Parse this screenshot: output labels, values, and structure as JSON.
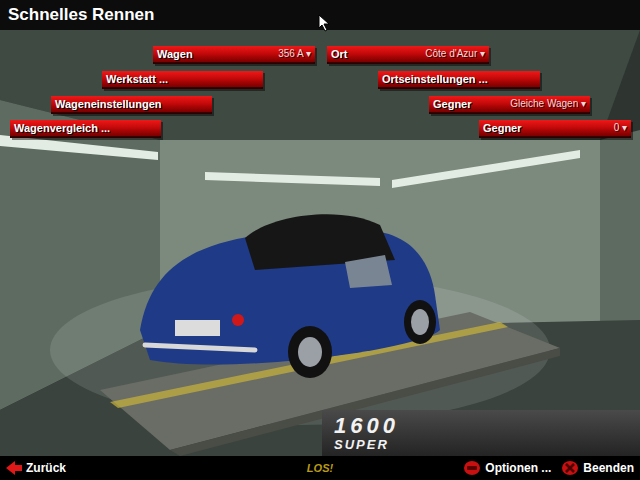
{
  "screen": {
    "title": "Schnelles Rennen"
  },
  "menu_left": [
    {
      "kind": "dropdown",
      "label": "Wagen",
      "value": "356 A",
      "arrow": "▾"
    },
    {
      "kind": "button",
      "label": "Werkstatt ..."
    },
    {
      "kind": "button",
      "label": "Wageneinstellungen"
    },
    {
      "kind": "button",
      "label": "Wagenvergleich ..."
    }
  ],
  "menu_right": [
    {
      "kind": "dropdown",
      "label": "Ort",
      "value": "Côte d'Azur",
      "arrow": "▾"
    },
    {
      "kind": "button",
      "label": "Ortseinstellungen ..."
    },
    {
      "kind": "dropdown",
      "label": "Gegner",
      "value": "Gleiche Wagen",
      "arrow": "▾"
    },
    {
      "kind": "dropdown",
      "label": "Gegner",
      "value": "0",
      "arrow": "▾"
    }
  ],
  "badge": {
    "line1": "1600",
    "line2": "SUPER"
  },
  "footer": {
    "back": "Zurück",
    "start": "LOS!",
    "options": "Optionen ...",
    "quit": "Beenden"
  }
}
